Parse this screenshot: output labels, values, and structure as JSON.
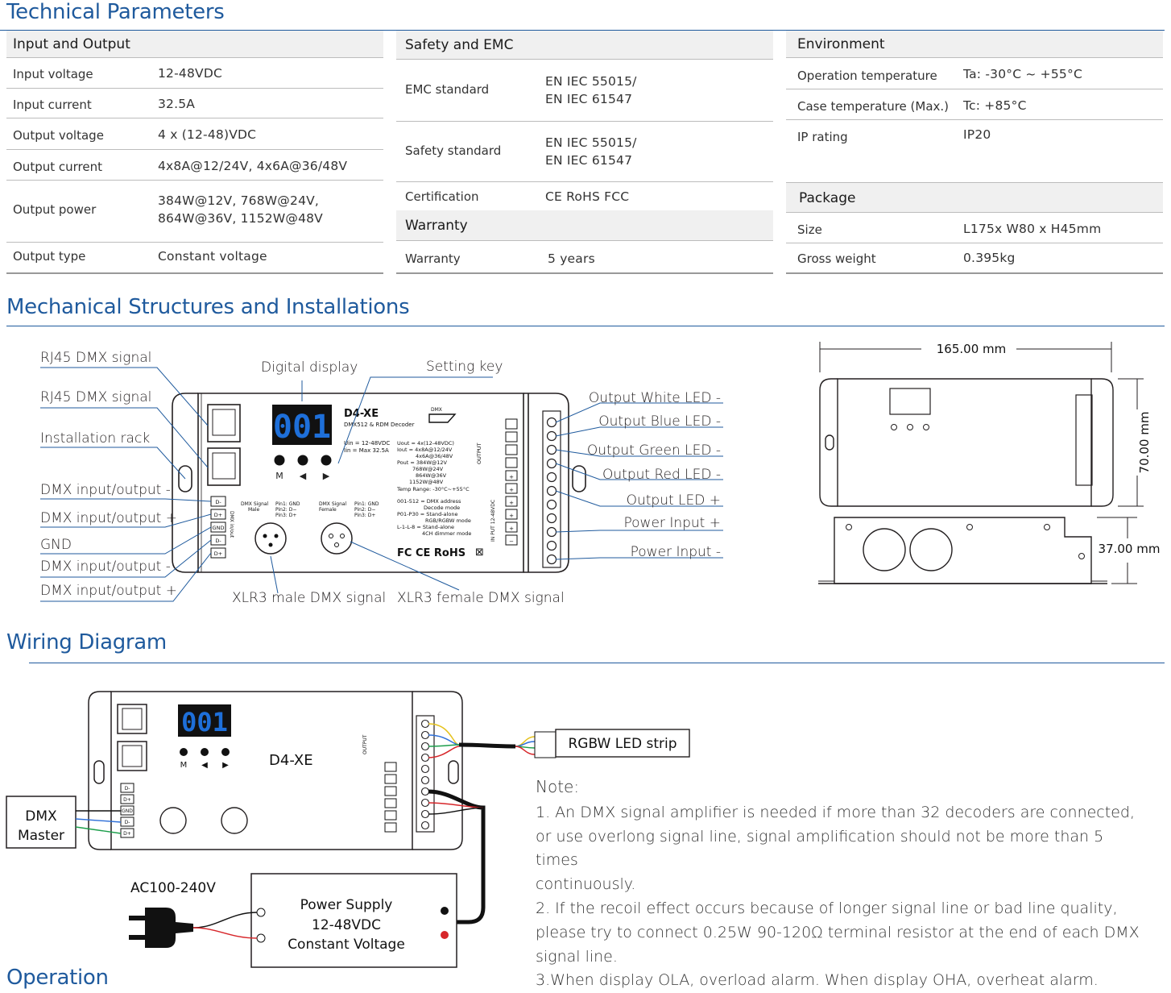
{
  "sections": {
    "technical": "Technical Parameters",
    "mechanical": "Mechanical Structures and Installations",
    "wiring": "Wiring Diagram",
    "operation": "Operation"
  },
  "io": {
    "header": "Input and Output",
    "rows": [
      {
        "label": "Input voltage",
        "value": "12-48VDC"
      },
      {
        "label": "Input current",
        "value": "32.5A"
      },
      {
        "label": "Output voltage",
        "value": "4 x (12-48)VDC"
      },
      {
        "label": "Output current",
        "value": "4x8A@12/24V, 4x6A@36/48V"
      },
      {
        "label": "Output power",
        "value": "384W@12V,   768W@24V,",
        "value2": "864W@36V, 1152W@48V"
      },
      {
        "label": "Output type",
        "value": "Constant voltage"
      }
    ]
  },
  "safety": {
    "header": "Safety and EMC",
    "rows": [
      {
        "label": "EMC standard",
        "value": "EN IEC 55015/",
        "value2": "EN IEC 61547"
      },
      {
        "label": "Safety standard",
        "value": "EN IEC 55015/",
        "value2": "EN IEC 61547"
      },
      {
        "label": "Certification",
        "value": "CE RoHS FCC"
      }
    ],
    "warranty_header": "Warranty",
    "warranty": {
      "label": "Warranty",
      "value": "5 years"
    }
  },
  "environment": {
    "header": "Environment",
    "rows": [
      {
        "label": "Operation temperature",
        "value": "Ta: -30°C ~ +55°C"
      },
      {
        "label": "Case temperature (Max.)",
        "value": "Tc: +85°C"
      },
      {
        "label": "IP rating",
        "value": "IP20"
      }
    ],
    "package_header": "Package",
    "package": [
      {
        "label": "Size",
        "value": "L175x W80 x H45mm"
      },
      {
        "label": "Gross weight",
        "value": "0.395kg"
      }
    ]
  },
  "mech": {
    "left_labels": [
      "RJ45 DMX signal",
      "RJ45 DMX signal",
      "Installation rack",
      "DMX input/output -",
      "DMX input/output +",
      "GND",
      "DMX input/output -",
      "DMX input/output +"
    ],
    "top_labels": [
      "Digital display",
      "Setting key"
    ],
    "right_labels": [
      "Output White LED -",
      "Output Blue LED -",
      "Output Green LED -",
      "Output Red LED -",
      "Output LED +",
      "Power Input +",
      "Power Input -"
    ],
    "bottom_labels": [
      "XLR3 male DMX signal",
      "XLR3 female DMX signal"
    ],
    "display_text": "001",
    "model": "D4-XE",
    "model_sub": "DMX512 & RDM Decoder",
    "keys": [
      "M",
      "◀",
      "▶"
    ],
    "spec_lines": [
      "Uin = 12-48VDC",
      "Iin  = Max 32.5A"
    ],
    "out_spec": [
      "Uout = 4x(12-48VDC)",
      "Iout  = 4x8A@12/24V",
      "4x6A@36/48V",
      "Pout = 384W@12V",
      "768W@24V",
      "864W@36V",
      "1152W@48V",
      "Temp Range: -30°C~+55°C"
    ],
    "mode_lines": [
      "001-512 = DMX address",
      "Decode mode",
      "P01-P30 = Stand-alone",
      "RGB/RGBW mode",
      "L-1-L-8 = Stand-alone",
      "4CH dimmer mode"
    ],
    "xlr_male": [
      "DMX Signal",
      "Male",
      "Pin1: GND",
      "Pin2: D−",
      "Pin3: D+"
    ],
    "xlr_female": [
      "DMX Signal",
      "Female",
      "Pin1: GND",
      "Pin2: D−",
      "Pin3: D+"
    ],
    "terms": [
      "D-",
      "D+",
      "GND",
      "D-",
      "D+"
    ],
    "dmx_inout": "DMX in/out",
    "output_label": "OUTPUT",
    "input_label": "IN PUT 12-48VDC",
    "cert_marks": "FC CE RoHS",
    "dims": {
      "length": "165.00 mm",
      "width": "70.00 mm",
      "height": "37.00 mm"
    }
  },
  "wiring": {
    "dmx_master": [
      "DMX",
      "Master"
    ],
    "strip": "RGBW LED strip",
    "ac": "AC100-240V",
    "psu": [
      "Power Supply",
      "12-48VDC",
      "Constant Voltage"
    ],
    "model": "D4-XE",
    "display_text": "001"
  },
  "note": {
    "title": "Note:",
    "lines": [
      "1. An DMX signal amplifier is needed if more than 32 decoders are connected,",
      "or use overlong signal line, signal amplification should not be more than 5 times",
      "continuously.",
      "2. If the recoil effect occurs because of longer signal line or bad line quality,",
      "please try to connect 0.25W 90-120Ω terminal resistor at the end of each DMX",
      "signal line.",
      "3.When display OLA, overload alarm. When display OHA, overheat alarm."
    ]
  },
  "colors": {
    "accent": "#1f5a9d",
    "display": "#1e6fd9",
    "wire_red": "#d7262a",
    "wire_green": "#1c9e4b",
    "wire_blue": "#2e6fd8",
    "wire_yellow": "#e5c21c"
  }
}
